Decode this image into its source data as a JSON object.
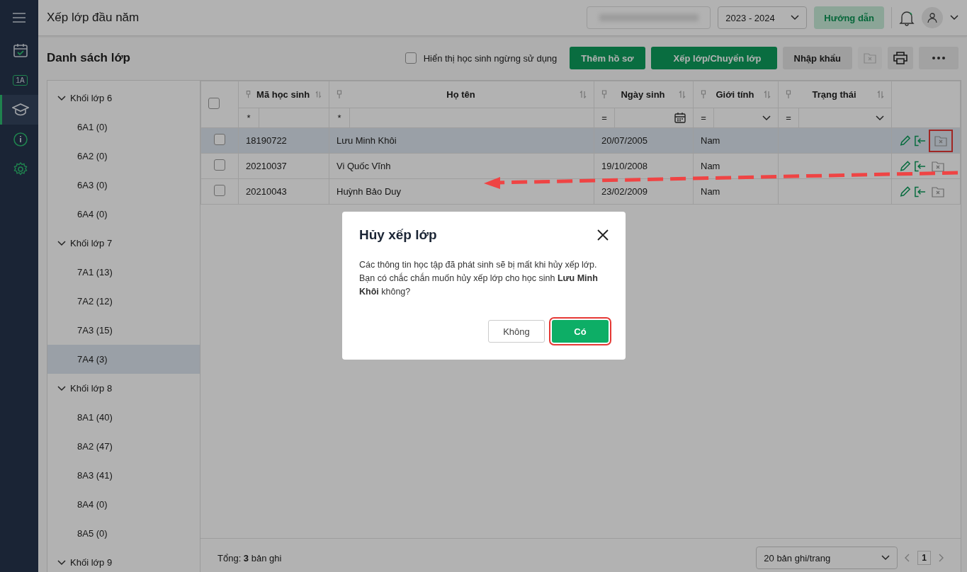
{
  "nav": {
    "items": [
      {
        "kind": "calendar",
        "selected": false
      },
      {
        "kind": "class",
        "label": "1A",
        "selected": false
      },
      {
        "kind": "school",
        "selected": true
      },
      {
        "kind": "info",
        "selected": false
      },
      {
        "kind": "settings",
        "selected": false
      }
    ]
  },
  "app_bar": {
    "title": "Xếp lớp đầu năm",
    "school_year": "2023 - 2024",
    "guide_button": "Hướng dẫn"
  },
  "toolbar": {
    "title": "Danh sách lớp",
    "show_inactive": {
      "label": "Hiển thị học sinh ngừng sử dụng",
      "checked": false
    },
    "buttons": [
      {
        "label": "Thêm hồ sơ",
        "kind": "primary"
      },
      {
        "label": "Xếp lớp/Chuyển lớp",
        "kind": "primary"
      },
      {
        "label": "Nhập khẩu",
        "kind": "secondary"
      }
    ],
    "icon_buttons": [
      {
        "kind": "remove",
        "disabled": true
      },
      {
        "kind": "print",
        "disabled": false
      },
      {
        "kind": "more",
        "disabled": false
      }
    ]
  },
  "tree": [
    {
      "label": "Khối lớp 6",
      "expanded": true,
      "children": [
        {
          "label": "6A1 (0)",
          "selected": false
        },
        {
          "label": "6A2 (0)",
          "selected": false
        },
        {
          "label": "6A3 (0)",
          "selected": false
        },
        {
          "label": "6A4 (0)",
          "selected": false
        }
      ]
    },
    {
      "label": "Khối lớp 7",
      "expanded": true,
      "children": [
        {
          "label": "7A1 (13)",
          "selected": false
        },
        {
          "label": "7A2 (12)",
          "selected": false
        },
        {
          "label": "7A3 (15)",
          "selected": false
        },
        {
          "label": "7A4 (3)",
          "selected": true
        }
      ]
    },
    {
      "label": "Khối lớp 8",
      "expanded": true,
      "children": [
        {
          "label": "8A1 (40)",
          "selected": false
        },
        {
          "label": "8A2 (47)",
          "selected": false
        },
        {
          "label": "8A3 (41)",
          "selected": false
        },
        {
          "label": "8A4 (0)",
          "selected": false
        },
        {
          "label": "8A5 (0)",
          "selected": false
        }
      ]
    },
    {
      "label": "Khối lớp 9",
      "expanded": true
    }
  ],
  "table": {
    "select_all_checked": false,
    "columns": [
      {
        "label": "Mã học sinh",
        "filter": "*",
        "kind": "text"
      },
      {
        "label": "Họ tên",
        "filter": "*",
        "kind": "text"
      },
      {
        "label": "Ngày sinh",
        "filter": "=",
        "kind": "date"
      },
      {
        "label": "Giới tính",
        "filter": "=",
        "kind": "select"
      },
      {
        "label": "Trạng thái",
        "filter": "=",
        "kind": "select"
      }
    ],
    "rows": [
      {
        "cells": [
          "18190722",
          "Lưu Minh Khôi",
          "20/07/2005",
          "Nam",
          ""
        ],
        "checked": false,
        "selected": true,
        "highlighted": true
      },
      {
        "cells": [
          "20210037",
          "Vi Quốc Vĩnh",
          "19/10/2008",
          "Nam",
          ""
        ],
        "checked": false,
        "selected": false,
        "highlighted": false
      },
      {
        "cells": [
          "20210043",
          "Huỳnh Bảo Duy",
          "23/02/2009",
          "Nam",
          ""
        ],
        "checked": false,
        "selected": false,
        "highlighted": false
      }
    ],
    "footer": {
      "total": "Tổng: **3** bản ghi",
      "page_size": "20 bản ghi/trang",
      "page": "1"
    }
  },
  "dialog": {
    "title": "Hủy xếp lớp",
    "message": "Các thông tin học tập đã phát sinh sẽ bị mất khi hủy xếp lớp. Bạn có chắc chắn muốn hủy xếp lớp cho học sinh **Lưu Minh Khôi** không?",
    "buttons": [
      {
        "label": "Không",
        "kind": "secondary",
        "highlighted": false
      },
      {
        "label": "Có",
        "kind": "primary",
        "highlighted": true
      }
    ]
  }
}
